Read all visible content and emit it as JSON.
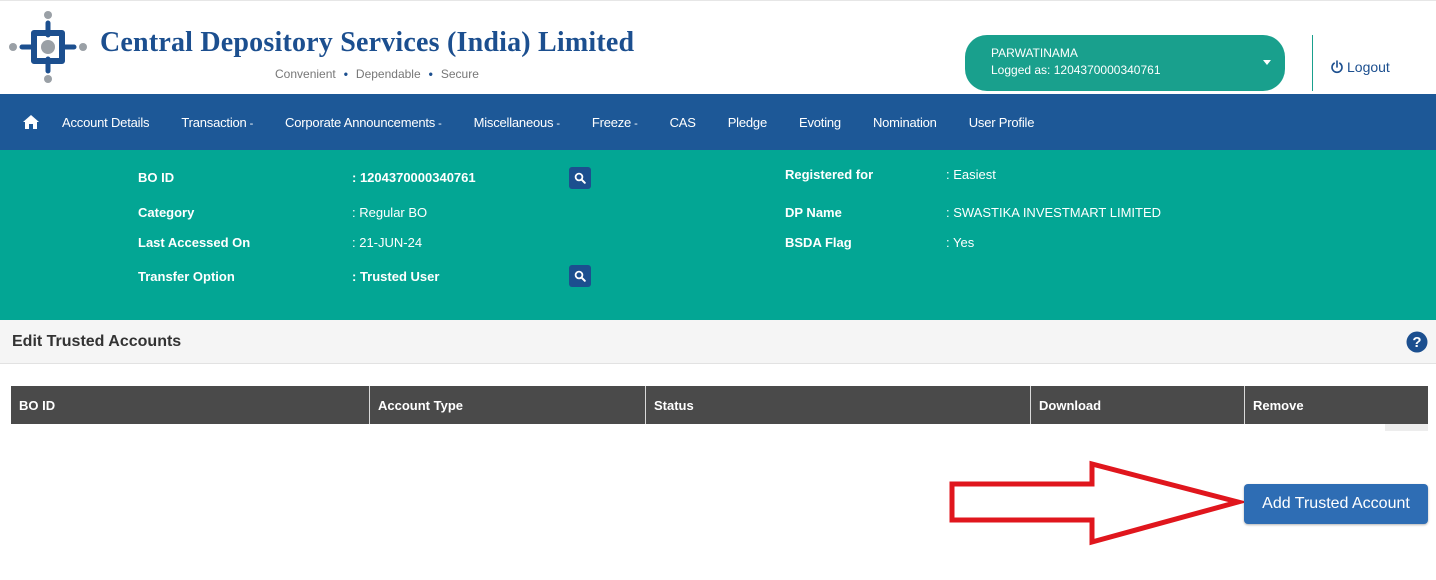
{
  "header": {
    "brand_title": "Central Depository Services (India) Limited",
    "tagline": [
      "Convenient",
      "Dependable",
      "Secure"
    ],
    "user_name": "PARWATINAMA",
    "logged_as": "Logged as: 1204370000340761",
    "logout_label": "Logout"
  },
  "nav": {
    "home_icon": "home-icon",
    "items": [
      {
        "label": "Account Details",
        "dropdown": ""
      },
      {
        "label": "Transaction",
        "dropdown": "-"
      },
      {
        "label": "Corporate Announcements",
        "dropdown": "-"
      },
      {
        "label": "Miscellaneous",
        "dropdown": "-"
      },
      {
        "label": "Freeze",
        "dropdown": "-"
      },
      {
        "label": "CAS",
        "dropdown": ""
      },
      {
        "label": "Pledge",
        "dropdown": ""
      },
      {
        "label": "Evoting",
        "dropdown": ""
      },
      {
        "label": "Nomination",
        "dropdown": ""
      },
      {
        "label": "User Profile",
        "dropdown": ""
      }
    ]
  },
  "info": {
    "bo_id_label": "BO ID",
    "bo_id_value": ": 1204370000340761",
    "category_label": "Category",
    "category_value": ": Regular BO",
    "last_accessed_label": "Last Accessed On",
    "last_accessed_value": ": 21-JUN-24",
    "transfer_option_label": "Transfer Option",
    "transfer_option_value": ": Trusted User",
    "registered_for_label": "Registered for",
    "registered_for_value": ": Easiest",
    "dp_name_label": "DP Name",
    "dp_name_value": ": SWASTIKA INVESTMART LIMITED",
    "bsda_flag_label": "BSDA Flag",
    "bsda_flag_value": ": Yes"
  },
  "section": {
    "title": "Edit Trusted Accounts"
  },
  "table": {
    "columns": [
      "BO ID",
      "Account Type",
      "Status",
      "Download",
      "Remove"
    ]
  },
  "actions": {
    "add_trusted_account": "Add Trusted Account"
  },
  "colors": {
    "brand_blue": "#1c4f8f",
    "nav_blue": "#1d5897",
    "teal": "#03a694",
    "pill_teal": "#19a08d",
    "table_header": "#4a4a4a",
    "button_blue": "#2e6db4",
    "arrow_red": "#e0161d"
  }
}
